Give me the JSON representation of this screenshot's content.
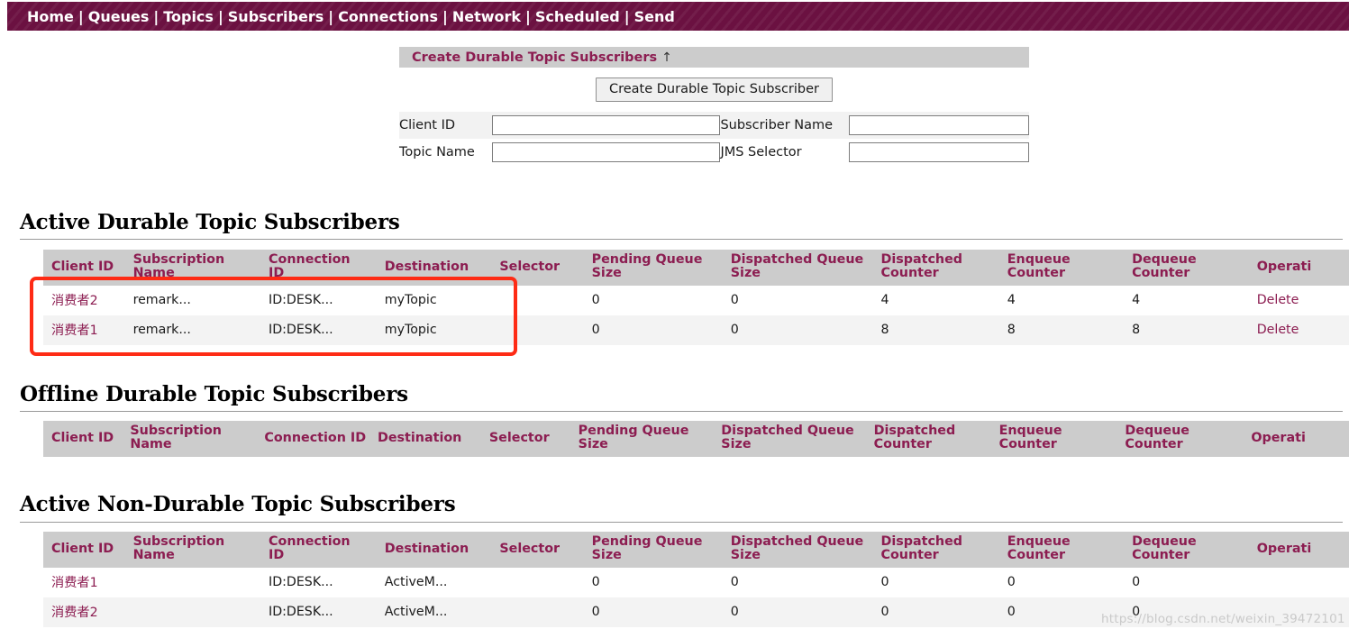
{
  "nav": {
    "separator": "|",
    "items": [
      {
        "label": "Home"
      },
      {
        "label": "Queues"
      },
      {
        "label": "Topics"
      },
      {
        "label": "Subscribers"
      },
      {
        "label": "Connections"
      },
      {
        "label": "Network"
      },
      {
        "label": "Scheduled"
      },
      {
        "label": "Send"
      }
    ]
  },
  "create_panel": {
    "header": "Create Durable Topic Subscribers",
    "header_arrow": "↑",
    "button_label": "Create Durable Topic Subscriber",
    "fields": {
      "client_id": {
        "label": "Client ID",
        "value": "",
        "placeholder": ""
      },
      "subscriber_name": {
        "label": "Subscriber Name",
        "value": "",
        "placeholder": ""
      },
      "topic_name": {
        "label": "Topic Name",
        "value": "",
        "placeholder": ""
      },
      "jms_selector": {
        "label": "JMS Selector",
        "value": "",
        "placeholder": ""
      }
    }
  },
  "columns": [
    "Client ID",
    "Subscription Name",
    "Connection ID",
    "Destination",
    "Selector",
    "Pending Queue Size",
    "Dispatched Queue Size",
    "Dispatched Counter",
    "Enqueue Counter",
    "Dequeue Counter",
    "Operations"
  ],
  "columns_clipped": {
    "operations": "Operati"
  },
  "sections": {
    "active_durable": {
      "title": "Active Durable Topic Subscribers",
      "rows": [
        {
          "client_id": "消费者2",
          "subscription_name": "remark...",
          "connection_id": "ID:DESK...",
          "destination": "myTopic",
          "selector": "",
          "pending_queue_size": "0",
          "dispatched_queue_size": "0",
          "dispatched_counter": "4",
          "enqueue_counter": "4",
          "dequeue_counter": "4",
          "operations": "Delete"
        },
        {
          "client_id": "消费者1",
          "subscription_name": "remark...",
          "connection_id": "ID:DESK...",
          "destination": "myTopic",
          "selector": "",
          "pending_queue_size": "0",
          "dispatched_queue_size": "0",
          "dispatched_counter": "8",
          "enqueue_counter": "8",
          "dequeue_counter": "8",
          "operations": "Delete"
        }
      ]
    },
    "offline_durable": {
      "title": "Offline Durable Topic Subscribers",
      "rows": []
    },
    "active_non_durable": {
      "title": "Active Non-Durable Topic Subscribers",
      "rows": [
        {
          "client_id": "消费者1",
          "subscription_name": "",
          "connection_id": "ID:DESK...",
          "destination": "ActiveM...",
          "selector": "",
          "pending_queue_size": "0",
          "dispatched_queue_size": "0",
          "dispatched_counter": "0",
          "enqueue_counter": "0",
          "dequeue_counter": "0",
          "operations": ""
        },
        {
          "client_id": "消费者2",
          "subscription_name": "",
          "connection_id": "ID:DESK...",
          "destination": "ActiveM...",
          "selector": "",
          "pending_queue_size": "0",
          "dispatched_queue_size": "0",
          "dispatched_counter": "0",
          "enqueue_counter": "0",
          "dequeue_counter": "0",
          "operations": ""
        }
      ]
    }
  },
  "annotation": {
    "shape": "rectangle",
    "color": "#fe2b15"
  },
  "watermark": "https://blog.csdn.net/weixin_39472101",
  "colors": {
    "nav_background": "#6b1141",
    "header_accent": "#8c1d51",
    "table_header_bg": "#cccccc",
    "row_alt_bg": "#f3f3f3",
    "annotation_red": "#fe2b15"
  }
}
